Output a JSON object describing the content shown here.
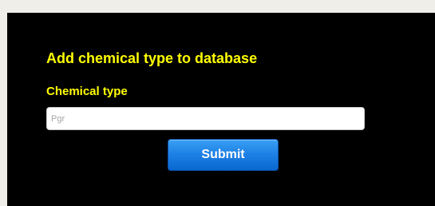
{
  "form": {
    "title": "Add chemical type to database",
    "field_label": "Chemical type",
    "input_value": "",
    "input_placeholder": "Pgr",
    "submit_label": "Submit"
  },
  "colors": {
    "page_background": "#f0eee9",
    "panel_background": "#000000",
    "label_text": "#ffff00",
    "button_blue": "#1f82e6",
    "button_text": "#ffffff"
  }
}
